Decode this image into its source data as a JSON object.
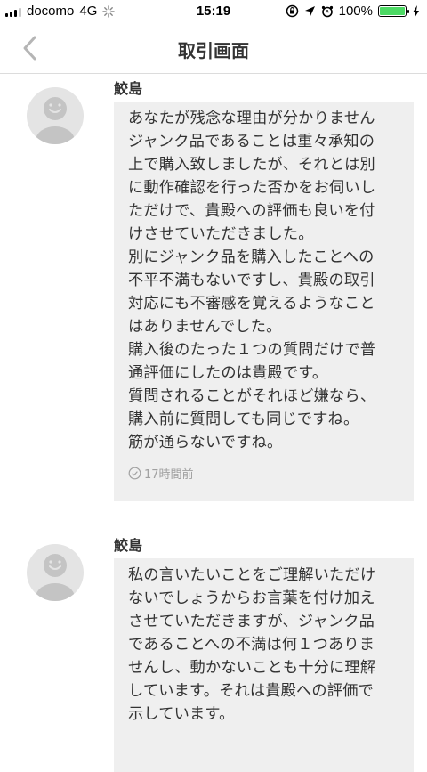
{
  "status_bar": {
    "carrier": "docomo",
    "network": "4G",
    "time": "15:19",
    "battery_percent": "100%",
    "battery_color": "#4cd964"
  },
  "nav": {
    "back_icon": "chevron-left-icon",
    "title": "取引画面"
  },
  "messages": [
    {
      "sender": "鮫島",
      "text": "あなたが残念な理由が分かりません\nジャンク品であることは重々承知の\n上で購入致しましたが、それとは別\nに動作確認を行った否かをお伺いし\nただけで、貴殿への評価も良いを付\nけさせていただきました。\n別にジャンク品を購入したことへの\n不平不満もないですし、貴殿の取引\n対応にも不審感を覚えるようなこと\nはありませんでした。\n購入後のたった１つの質問だけで普\n通評価にしたのは貴殿です。\n質問されることがそれほど嫌なら、\n購入前に質問しても同じですね。\n筋が通らないですね。",
      "timestamp": "17時間前"
    },
    {
      "sender": "鮫島",
      "text": "私の言いたいことをご理解いただけ\nないでしょうからお言葉を付け加え\nさせていただきますが、ジャンク品\nであることへの不満は何１つありま\nせんし、動かないことも十分に理解\nしています。それは貴殿への評価で\n示しています。"
    }
  ]
}
